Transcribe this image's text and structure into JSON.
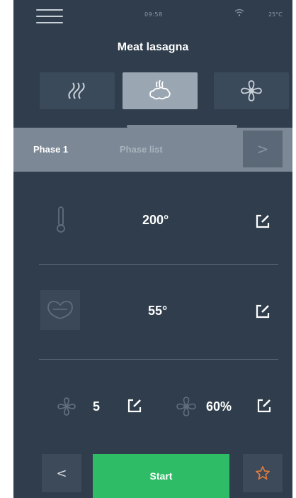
{
  "status": {
    "time": "09:58",
    "temperature": "25°C",
    "wifi_icon": "wifi-icon"
  },
  "header": {
    "title": "Meat lasagna",
    "menu_icon": "hamburger-menu-icon"
  },
  "modes": [
    {
      "icon": "convection-heat-icon",
      "active": false
    },
    {
      "icon": "steam-icon",
      "active": true
    },
    {
      "icon": "fan-icon",
      "active": false
    }
  ],
  "phase": {
    "current_label": "Phase 1",
    "list_label": "Phase list",
    "next_icon": "chevron-right-icon"
  },
  "settings": {
    "temperature": {
      "value": "200°",
      "icon": "thermometer-icon"
    },
    "core_probe": {
      "value": "55°",
      "icon": "core-probe-icon"
    },
    "fan_speed": {
      "value": "5",
      "icon": "fan-speed-icon"
    },
    "humidity": {
      "value": "60%",
      "icon": "humidity-icon"
    }
  },
  "footer": {
    "back_icon": "chevron-left-icon",
    "start_label": "Start",
    "favorite_icon": "star-icon"
  },
  "colors": {
    "background": "#2f3d4c",
    "accent_green": "#2ebd66",
    "phase_bar": "#7c8896",
    "star": "#e07a3c"
  }
}
